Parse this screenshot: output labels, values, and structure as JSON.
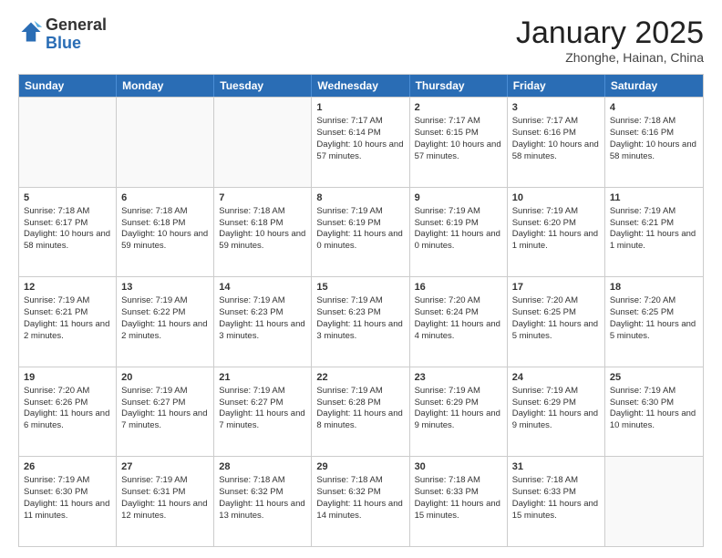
{
  "header": {
    "logo_general": "General",
    "logo_blue": "Blue",
    "title": "January 2025",
    "subtitle": "Zhonghe, Hainan, China"
  },
  "days_of_week": [
    "Sunday",
    "Monday",
    "Tuesday",
    "Wednesday",
    "Thursday",
    "Friday",
    "Saturday"
  ],
  "weeks": [
    [
      {
        "day": "",
        "info": "",
        "empty": true
      },
      {
        "day": "",
        "info": "",
        "empty": true
      },
      {
        "day": "",
        "info": "",
        "empty": true
      },
      {
        "day": "1",
        "info": "Sunrise: 7:17 AM\nSunset: 6:14 PM\nDaylight: 10 hours and 57 minutes.",
        "empty": false
      },
      {
        "day": "2",
        "info": "Sunrise: 7:17 AM\nSunset: 6:15 PM\nDaylight: 10 hours and 57 minutes.",
        "empty": false
      },
      {
        "day": "3",
        "info": "Sunrise: 7:17 AM\nSunset: 6:16 PM\nDaylight: 10 hours and 58 minutes.",
        "empty": false
      },
      {
        "day": "4",
        "info": "Sunrise: 7:18 AM\nSunset: 6:16 PM\nDaylight: 10 hours and 58 minutes.",
        "empty": false
      }
    ],
    [
      {
        "day": "5",
        "info": "Sunrise: 7:18 AM\nSunset: 6:17 PM\nDaylight: 10 hours and 58 minutes.",
        "empty": false
      },
      {
        "day": "6",
        "info": "Sunrise: 7:18 AM\nSunset: 6:18 PM\nDaylight: 10 hours and 59 minutes.",
        "empty": false
      },
      {
        "day": "7",
        "info": "Sunrise: 7:18 AM\nSunset: 6:18 PM\nDaylight: 10 hours and 59 minutes.",
        "empty": false
      },
      {
        "day": "8",
        "info": "Sunrise: 7:19 AM\nSunset: 6:19 PM\nDaylight: 11 hours and 0 minutes.",
        "empty": false
      },
      {
        "day": "9",
        "info": "Sunrise: 7:19 AM\nSunset: 6:19 PM\nDaylight: 11 hours and 0 minutes.",
        "empty": false
      },
      {
        "day": "10",
        "info": "Sunrise: 7:19 AM\nSunset: 6:20 PM\nDaylight: 11 hours and 1 minute.",
        "empty": false
      },
      {
        "day": "11",
        "info": "Sunrise: 7:19 AM\nSunset: 6:21 PM\nDaylight: 11 hours and 1 minute.",
        "empty": false
      }
    ],
    [
      {
        "day": "12",
        "info": "Sunrise: 7:19 AM\nSunset: 6:21 PM\nDaylight: 11 hours and 2 minutes.",
        "empty": false
      },
      {
        "day": "13",
        "info": "Sunrise: 7:19 AM\nSunset: 6:22 PM\nDaylight: 11 hours and 2 minutes.",
        "empty": false
      },
      {
        "day": "14",
        "info": "Sunrise: 7:19 AM\nSunset: 6:23 PM\nDaylight: 11 hours and 3 minutes.",
        "empty": false
      },
      {
        "day": "15",
        "info": "Sunrise: 7:19 AM\nSunset: 6:23 PM\nDaylight: 11 hours and 3 minutes.",
        "empty": false
      },
      {
        "day": "16",
        "info": "Sunrise: 7:20 AM\nSunset: 6:24 PM\nDaylight: 11 hours and 4 minutes.",
        "empty": false
      },
      {
        "day": "17",
        "info": "Sunrise: 7:20 AM\nSunset: 6:25 PM\nDaylight: 11 hours and 5 minutes.",
        "empty": false
      },
      {
        "day": "18",
        "info": "Sunrise: 7:20 AM\nSunset: 6:25 PM\nDaylight: 11 hours and 5 minutes.",
        "empty": false
      }
    ],
    [
      {
        "day": "19",
        "info": "Sunrise: 7:20 AM\nSunset: 6:26 PM\nDaylight: 11 hours and 6 minutes.",
        "empty": false
      },
      {
        "day": "20",
        "info": "Sunrise: 7:19 AM\nSunset: 6:27 PM\nDaylight: 11 hours and 7 minutes.",
        "empty": false
      },
      {
        "day": "21",
        "info": "Sunrise: 7:19 AM\nSunset: 6:27 PM\nDaylight: 11 hours and 7 minutes.",
        "empty": false
      },
      {
        "day": "22",
        "info": "Sunrise: 7:19 AM\nSunset: 6:28 PM\nDaylight: 11 hours and 8 minutes.",
        "empty": false
      },
      {
        "day": "23",
        "info": "Sunrise: 7:19 AM\nSunset: 6:29 PM\nDaylight: 11 hours and 9 minutes.",
        "empty": false
      },
      {
        "day": "24",
        "info": "Sunrise: 7:19 AM\nSunset: 6:29 PM\nDaylight: 11 hours and 9 minutes.",
        "empty": false
      },
      {
        "day": "25",
        "info": "Sunrise: 7:19 AM\nSunset: 6:30 PM\nDaylight: 11 hours and 10 minutes.",
        "empty": false
      }
    ],
    [
      {
        "day": "26",
        "info": "Sunrise: 7:19 AM\nSunset: 6:30 PM\nDaylight: 11 hours and 11 minutes.",
        "empty": false
      },
      {
        "day": "27",
        "info": "Sunrise: 7:19 AM\nSunset: 6:31 PM\nDaylight: 11 hours and 12 minutes.",
        "empty": false
      },
      {
        "day": "28",
        "info": "Sunrise: 7:18 AM\nSunset: 6:32 PM\nDaylight: 11 hours and 13 minutes.",
        "empty": false
      },
      {
        "day": "29",
        "info": "Sunrise: 7:18 AM\nSunset: 6:32 PM\nDaylight: 11 hours and 14 minutes.",
        "empty": false
      },
      {
        "day": "30",
        "info": "Sunrise: 7:18 AM\nSunset: 6:33 PM\nDaylight: 11 hours and 15 minutes.",
        "empty": false
      },
      {
        "day": "31",
        "info": "Sunrise: 7:18 AM\nSunset: 6:33 PM\nDaylight: 11 hours and 15 minutes.",
        "empty": false
      },
      {
        "day": "",
        "info": "",
        "empty": true
      }
    ]
  ]
}
